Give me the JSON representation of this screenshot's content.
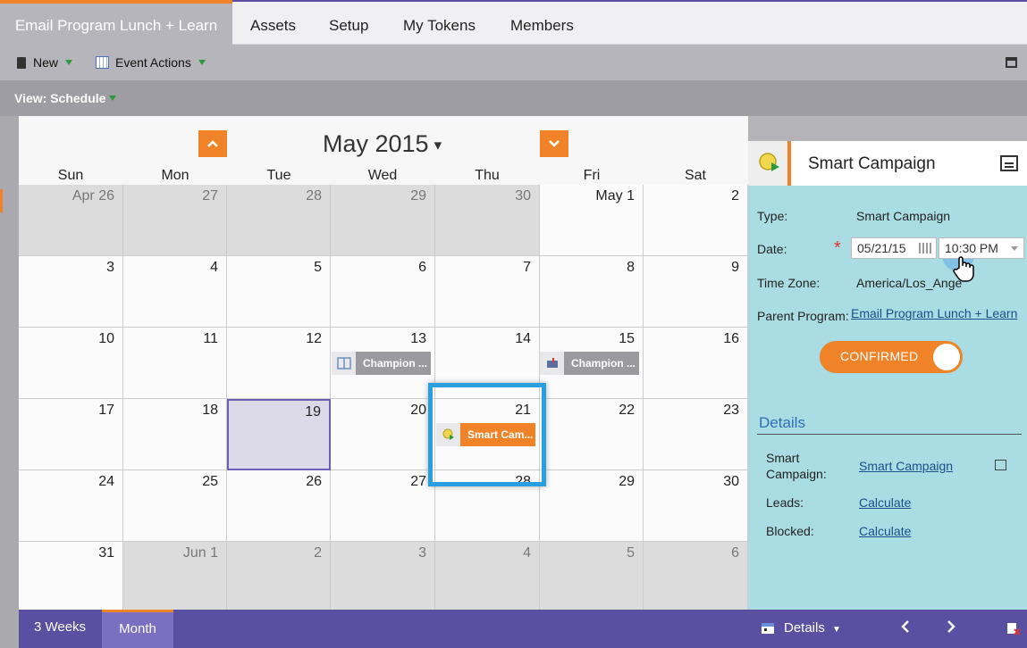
{
  "tabs": [
    {
      "label": "Email Program Lunch + Learn",
      "active": true
    },
    {
      "label": "Assets"
    },
    {
      "label": "Setup"
    },
    {
      "label": "My Tokens"
    },
    {
      "label": "Members"
    }
  ],
  "toolbar": {
    "new_label": "New",
    "event_actions_label": "Event Actions"
  },
  "viewbar": {
    "label": "View: Schedule"
  },
  "calendar": {
    "title": "May 2015",
    "caret": "▾",
    "days_of_week": [
      "Sun",
      "Mon",
      "Tue",
      "Wed",
      "Thu",
      "Fri",
      "Sat"
    ],
    "weeks": [
      [
        "Apr 26",
        "27",
        "28",
        "29",
        "30",
        "May 1",
        "2"
      ],
      [
        "3",
        "4",
        "5",
        "6",
        "7",
        "8",
        "9"
      ],
      [
        "10",
        "11",
        "12",
        "13",
        "14",
        "15",
        "16"
      ],
      [
        "17",
        "18",
        "19",
        "20",
        "21",
        "22",
        "23"
      ],
      [
        "24",
        "25",
        "26",
        "27",
        "28",
        "29",
        "30"
      ],
      [
        "31",
        "Jun 1",
        "2",
        "3",
        "4",
        "5",
        "6"
      ]
    ],
    "events": [
      {
        "label": "Champion ..."
      },
      {
        "label": "Champion ..."
      },
      {
        "label": "Smart Cam..."
      }
    ]
  },
  "bottom_bar": {
    "three_weeks": "3 Weeks",
    "month": "Month"
  },
  "panel": {
    "title": "Smart Campaign",
    "type_label": "Type:",
    "type_value": "Smart Campaign",
    "date_label": "Date:",
    "required_mark": "*",
    "date_value": "05/21/15",
    "time_value": "10:30 PM",
    "timezone_label": "Time Zone:",
    "timezone_value": "America/Los_Ange",
    "parent_label": "Parent Program:",
    "parent_value": "Email Program Lunch + Learn",
    "toggle_label": "CONFIRMED",
    "details_heading": "Details",
    "smart_campaign_label_1": "Smart",
    "smart_campaign_label_2": "Campaign:",
    "smart_campaign_value": "Smart Campaign",
    "leads_label": "Leads:",
    "leads_value": "Calculate",
    "blocked_label": "Blocked:",
    "blocked_value": "Calculate"
  },
  "panel_bottom": {
    "details_label": "Details"
  },
  "colors": {
    "accent": "#f08227",
    "purple": "#5a4fa0",
    "highlight": "#2a9fe0",
    "panel_bg": "#a9dde3"
  }
}
